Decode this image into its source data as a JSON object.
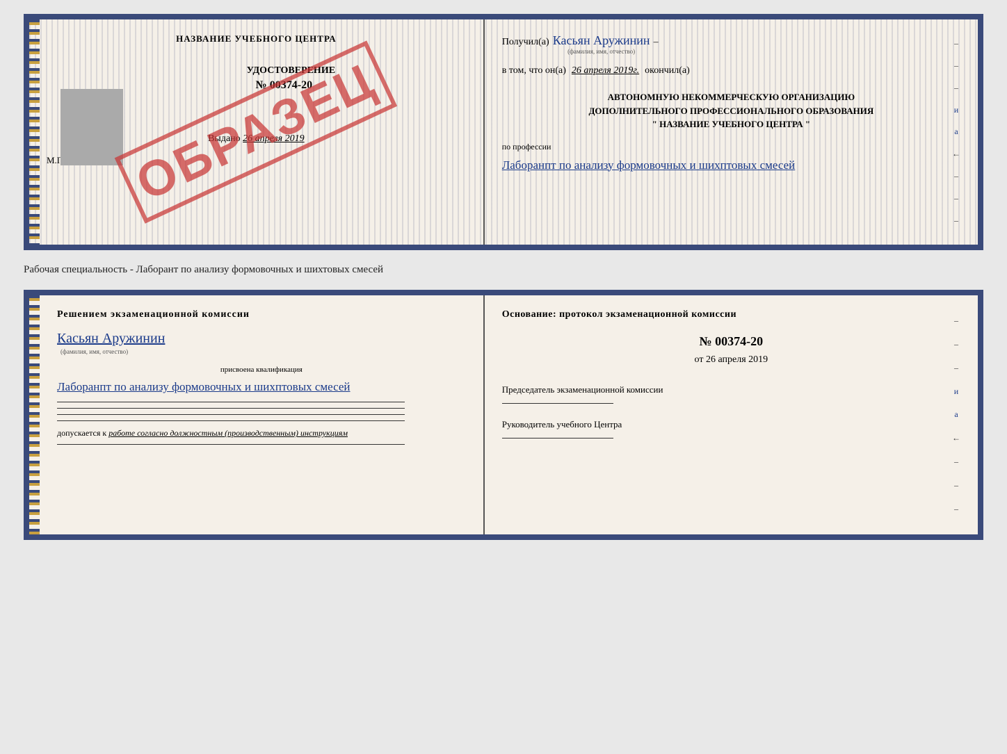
{
  "page": {
    "background": "#e8e8e8"
  },
  "top_document": {
    "left": {
      "title": "НАЗВАНИЕ УЧЕБНОГО ЦЕНТРА",
      "cert_type": "УДОСТОВЕРЕНИЕ",
      "cert_number": "№ 00374-20",
      "issued_label": "Выдано",
      "issued_date": "26 апреля 2019",
      "mp_label": "М.П.",
      "stamp_text": "ОБРАЗЕЦ"
    },
    "right": {
      "received_label": "Получил(а)",
      "name_handwritten": "Касьян Аружинин",
      "name_subtext": "(фамилия, имя, отчество)",
      "date_prefix": "в том, что он(а)",
      "date_value": "26 апреля 2019г.",
      "date_suffix": "окончил(а)",
      "org_line1": "АВТОНОМНУЮ НЕКОММЕРЧЕСКУЮ ОРГАНИЗАЦИЮ",
      "org_line2": "ДОПОЛНИТЕЛЬНОГО ПРОФЕССИОНАЛЬНОГО ОБРАЗОВАНИЯ",
      "org_line3": "\" НАЗВАНИЕ УЧЕБНОГО ЦЕНТРА \"",
      "profession_label": "по профессии",
      "profession_handwritten": "Лаборанпт по анализу формовочных и шихптовых смесей"
    }
  },
  "specialty_text": "Рабочая специальность - Лаборант по анализу формовочных и шихтовых смесей",
  "bottom_document": {
    "left": {
      "decision_title": "Решением экзаменационной комиссии",
      "name_handwritten": "Касьян Аружинин",
      "fio_subtext": "(фамилия, имя, отчество)",
      "qualification_label": "присвоена квалификация",
      "qualification_handwritten": "Лаборанпт по анализу формовочных и шихптовых смесей",
      "допускается_prefix": "допускается к",
      "допускается_text": "работе согласно должностным (производственным) инструкциям"
    },
    "right": {
      "osnovaniye": "Основание: протокол экзаменационной комиссии",
      "protocol_number": "№ 00374-20",
      "protocol_date_prefix": "от",
      "protocol_date": "26 апреля 2019",
      "chairman_label": "Председатель экзаменационной комиссии",
      "director_label": "Руководитель учебного Центра"
    }
  }
}
